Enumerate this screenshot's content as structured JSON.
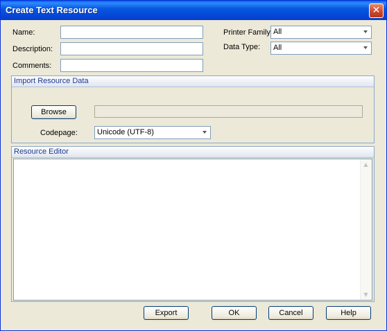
{
  "window": {
    "title": "Create Text Resource",
    "close_symbol": "✕"
  },
  "form": {
    "name_label": "Name:",
    "name_value": "",
    "description_label": "Description:",
    "description_value": "",
    "comments_label": "Comments:",
    "comments_value": "",
    "printer_family_label": "Printer Family:",
    "printer_family_value": "All",
    "data_type_label": "Data Type:",
    "data_type_value": "All"
  },
  "import": {
    "header": "Import Resource Data",
    "browse_label": "Browse",
    "path_value": "",
    "codepage_label": "Codepage:",
    "codepage_value": "Unicode (UTF-8)"
  },
  "editor": {
    "header": "Resource Editor",
    "content": "",
    "scroll_up_icon": "▲",
    "scroll_down_icon": "▼"
  },
  "buttons": {
    "export": "Export",
    "ok": "OK",
    "cancel": "Cancel",
    "help": "Help"
  }
}
